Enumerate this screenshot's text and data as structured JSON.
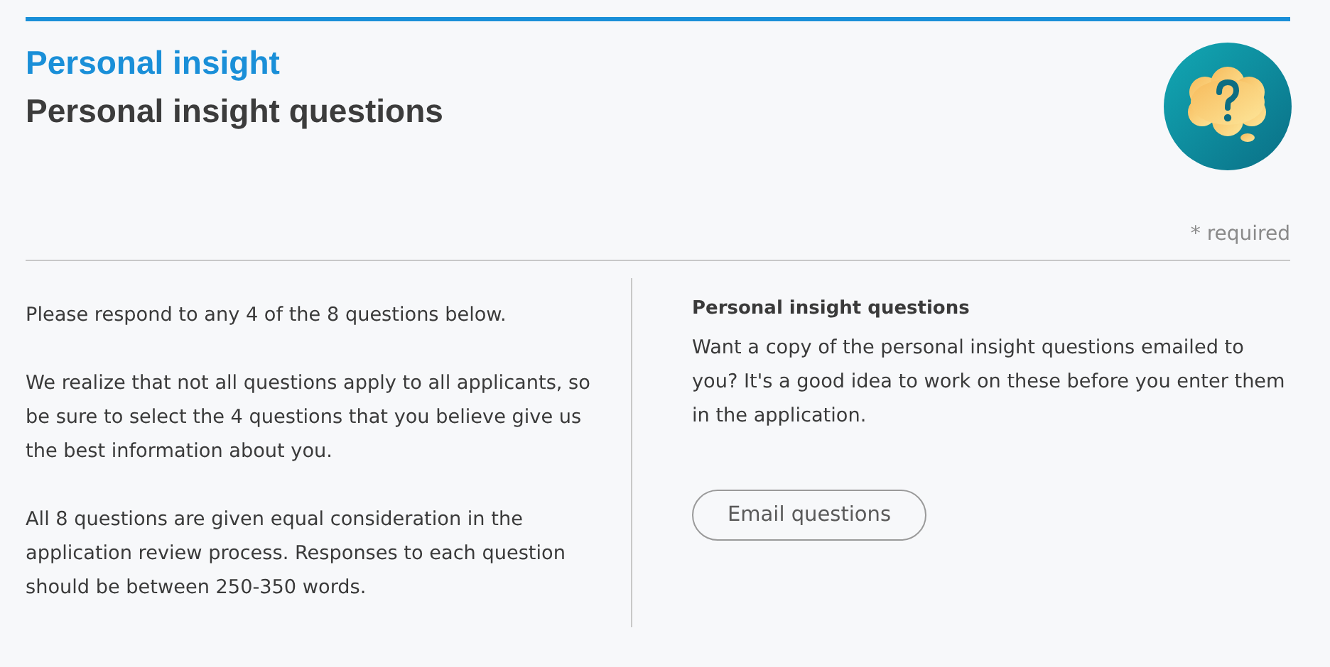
{
  "header": {
    "section": "Personal insight",
    "title": "Personal insight questions"
  },
  "required_note": "* required",
  "left_paragraphs": [
    "Please respond to any 4 of the 8 questions below.",
    "We realize that not all questions apply to all applicants, so be sure to select the 4 questions that you believe give us the best information about you.",
    "All 8 questions are given equal consideration in the application review process. Responses to each question should be between 250-350 words."
  ],
  "right": {
    "heading": "Personal insight questions",
    "text": "Want a copy of the personal insight questions emailed to you? It's a good idea to work on these before you enter them in the application.",
    "button": "Email questions"
  }
}
